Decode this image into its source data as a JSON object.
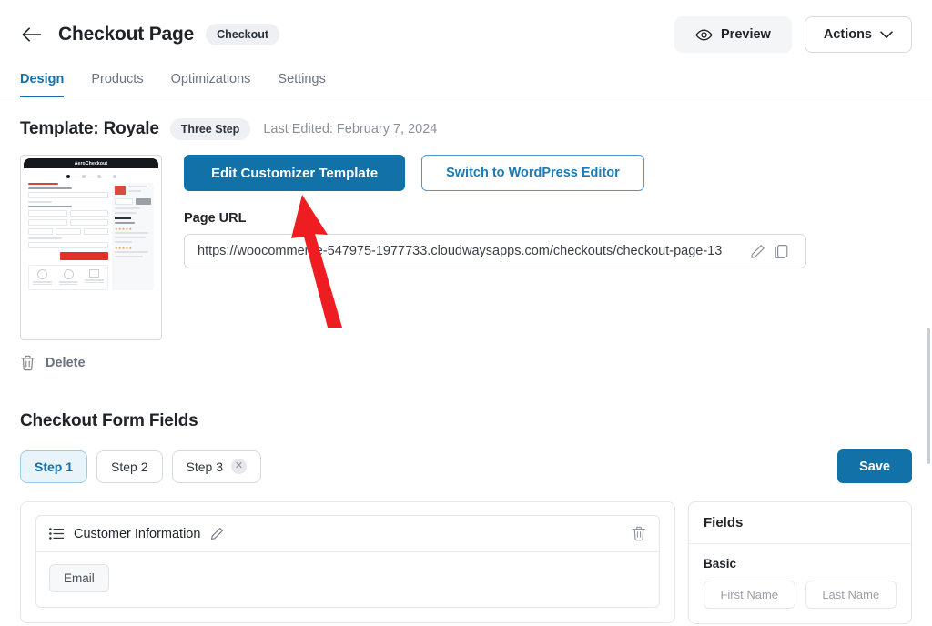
{
  "header": {
    "back_icon": "arrow-left-icon",
    "title": "Checkout Page",
    "badge": "Checkout",
    "preview_label": "Preview",
    "preview_icon": "eye-icon",
    "actions_label": "Actions",
    "actions_icon": "chevron-down-icon"
  },
  "tabs": [
    {
      "label": "Design",
      "active": true
    },
    {
      "label": "Products",
      "active": false
    },
    {
      "label": "Optimizations",
      "active": false
    },
    {
      "label": "Settings",
      "active": false
    }
  ],
  "template": {
    "title": "Template: Royale",
    "badge": "Three Step",
    "last_edited": "Last Edited: February 7, 2024",
    "thumbnail_logo": "AeroCheckout",
    "edit_button": "Edit Customizer Template",
    "switch_button": "Switch to WordPress Editor",
    "url_label": "Page URL",
    "url_value": "https://woocommerce-547975-1977733.cloudwaysapps.com/checkouts/checkout-page-13",
    "url_edit_icon": "pencil-icon",
    "url_copy_icon": "copy-icon",
    "delete_label": "Delete",
    "delete_icon": "trash-icon"
  },
  "form_fields": {
    "title": "Checkout Form Fields",
    "steps": [
      {
        "label": "Step 1",
        "active": true,
        "closable": false
      },
      {
        "label": "Step 2",
        "active": false,
        "closable": false
      },
      {
        "label": "Step 3",
        "active": false,
        "closable": true
      }
    ],
    "save_label": "Save",
    "groups": [
      {
        "title": "Customer Information",
        "drag_icon": "list-icon",
        "edit_icon": "pencil-icon",
        "delete_icon": "trash-icon",
        "fields": [
          "Email"
        ]
      }
    ]
  },
  "fields_panel": {
    "title": "Fields",
    "groups": [
      {
        "label": "Basic",
        "chips": [
          "First Name",
          "Last Name"
        ]
      }
    ]
  },
  "annotation": {
    "type": "arrow",
    "color": "#ee1d21",
    "points_to": "Edit Customizer Template"
  },
  "colors": {
    "primary_blue": "#1272a8",
    "link_blue": "#1571a8",
    "annotation_red": "#ee1d21",
    "muted_text": "#8a9099",
    "border": "#d6dae0"
  }
}
